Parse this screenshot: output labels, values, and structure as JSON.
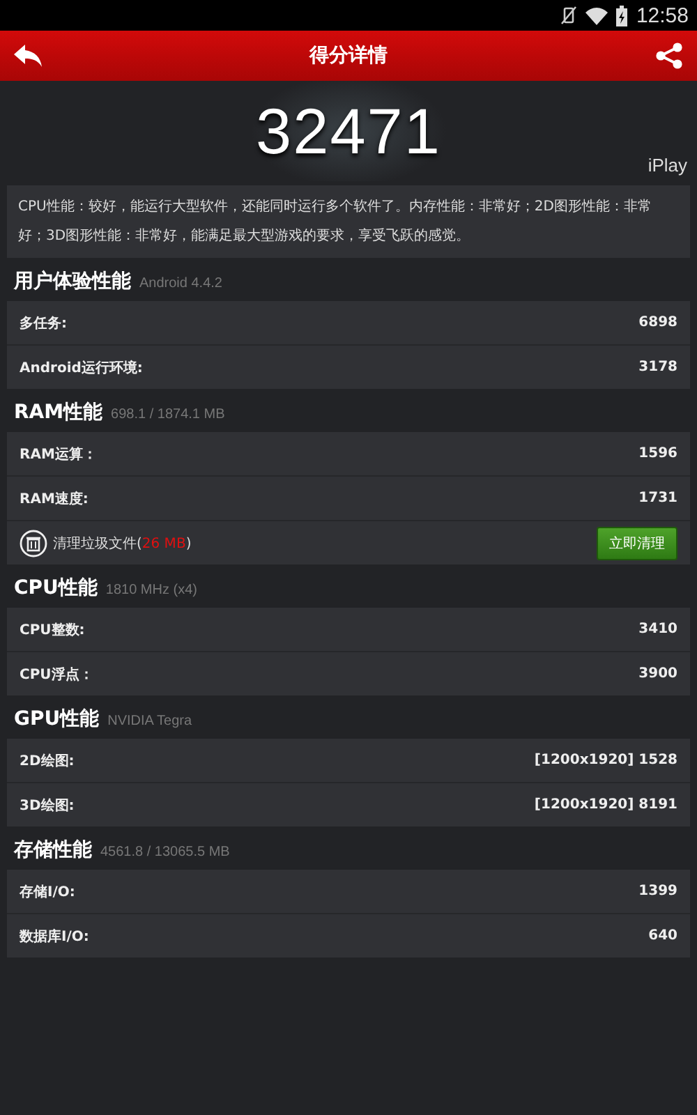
{
  "status_bar": {
    "time": "12:58"
  },
  "header": {
    "title": "得分详情"
  },
  "score": {
    "value": "32471",
    "device": "iPlay"
  },
  "summary": "CPU性能：较好，能运行大型软件，还能同时运行多个软件了。内存性能：非常好；2D图形性能：非常好；3D图形性能：非常好，能满足最大型游戏的要求，享受飞跃的感觉。",
  "sections": [
    {
      "title": "用户体验性能",
      "subtitle": "Android 4.4.2",
      "rows": [
        {
          "kind": "score",
          "label": "多任务:",
          "value": "6898"
        },
        {
          "kind": "score",
          "label": "Android运行环境:",
          "value": "3178"
        }
      ]
    },
    {
      "title": "RAM性能",
      "subtitle": "698.1 / 1874.1 MB",
      "rows": [
        {
          "kind": "score",
          "label": "RAM运算：",
          "value": "1596"
        },
        {
          "kind": "score",
          "label": "RAM速度:",
          "value": "1731"
        },
        {
          "kind": "cleanup",
          "label": "清理垃圾文件(",
          "amount": "26 MB",
          "close": ")",
          "button": "立即清理"
        }
      ]
    },
    {
      "title": "CPU性能",
      "subtitle": "1810 MHz (x4)",
      "rows": [
        {
          "kind": "score",
          "label": "CPU整数:",
          "value": "3410"
        },
        {
          "kind": "score",
          "label": "CPU浮点：",
          "value": "3900"
        }
      ]
    },
    {
      "title": "GPU性能",
      "subtitle": "NVIDIA Tegra",
      "rows": [
        {
          "kind": "score",
          "label": "2D绘图:",
          "value": "[1200x1920] 1528"
        },
        {
          "kind": "score",
          "label": "3D绘图:",
          "value": "[1200x1920] 8191"
        }
      ]
    },
    {
      "title": "存储性能",
      "subtitle": "4561.8 / 13065.5 MB",
      "rows": [
        {
          "kind": "score",
          "label": "存储I/O:",
          "value": "1399"
        },
        {
          "kind": "score",
          "label": "数据库I/O:",
          "value": "640"
        }
      ]
    }
  ]
}
